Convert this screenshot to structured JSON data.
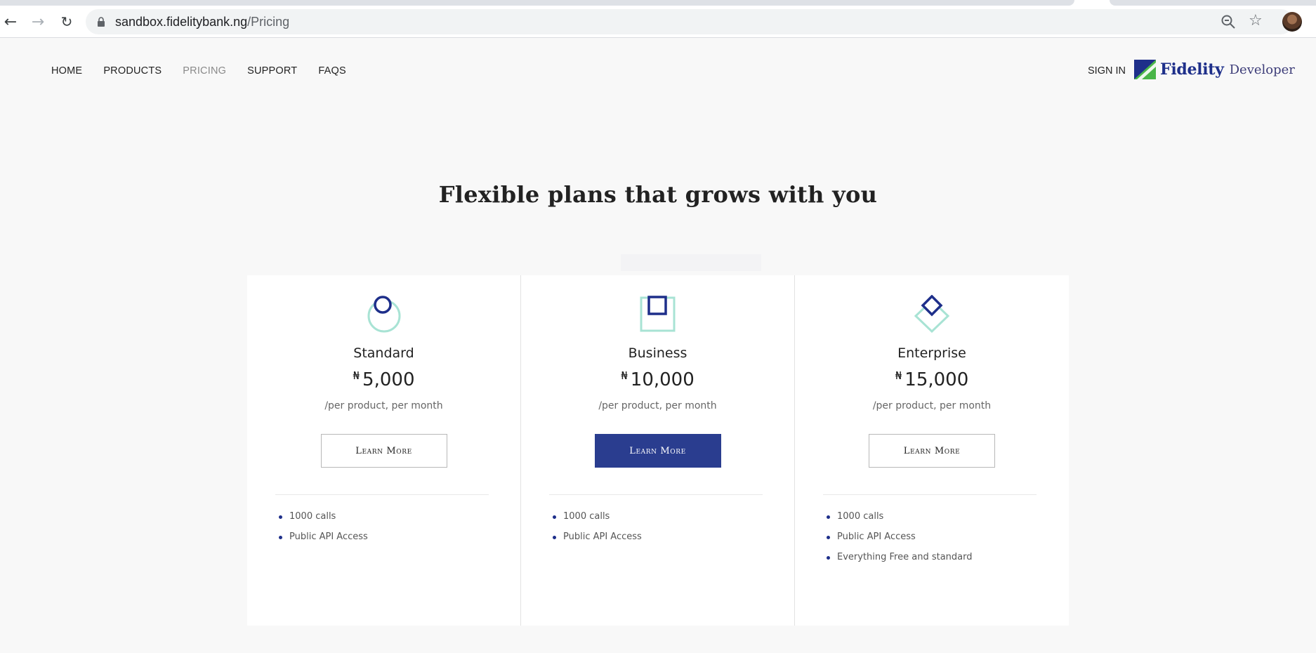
{
  "browser": {
    "url_host": "sandbox.fidelitybank.ng",
    "url_path": "/Pricing"
  },
  "nav": {
    "items": [
      {
        "label": "HOME"
      },
      {
        "label": "PRODUCTS"
      },
      {
        "label": "PRICING"
      },
      {
        "label": "SUPPORT"
      },
      {
        "label": "FAQS"
      }
    ],
    "active": "PRICING",
    "signin": "SIGN IN",
    "logo_brand": "Fidelity",
    "logo_sub": "Developer"
  },
  "hero": {
    "title": "Flexible plans that grows with you"
  },
  "colors": {
    "primary": "#2a3d8f",
    "accent_mint": "#a8e3d4",
    "navy": "#1e2f8a"
  },
  "plans": [
    {
      "name": "Standard",
      "currency": "₦",
      "price": "5,000",
      "period": "/per product, per month",
      "button": "Learn More",
      "icon": "circle-icon",
      "features": [
        "1000 calls",
        "Public API Access"
      ]
    },
    {
      "name": "Business",
      "currency": "₦",
      "price": "10,000",
      "period": "/per product, per month",
      "button": "Learn More",
      "icon": "square-icon",
      "features": [
        "1000 calls",
        "Public API Access"
      ]
    },
    {
      "name": "Enterprise",
      "currency": "₦",
      "price": "15,000",
      "period": "/per product, per month",
      "button": "Learn More",
      "icon": "diamond-icon",
      "features": [
        "1000 calls",
        "Public API Access",
        "Everything Free and standard"
      ]
    }
  ]
}
